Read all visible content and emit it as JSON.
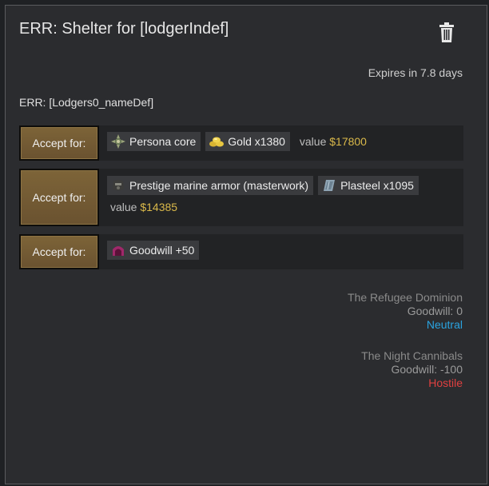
{
  "dialog": {
    "title": "ERR: Shelter for [lodgerIndef]",
    "expires": "Expires in 7.8 days",
    "subtitle": "ERR: [Lodgers0_nameDef]",
    "trash_icon": "trash-icon"
  },
  "options": [
    {
      "accept_label": "Accept for:",
      "items": [
        {
          "label": "Persona core",
          "icon": "persona-core-icon"
        },
        {
          "label": "Gold x1380",
          "icon": "gold-icon"
        }
      ],
      "value_label": "value",
      "value_amount": "$17800"
    },
    {
      "accept_label": "Accept for:",
      "items": [
        {
          "label": "Prestige marine armor (masterwork)",
          "icon": "armor-icon"
        },
        {
          "label": "Plasteel x1095",
          "icon": "plasteel-icon"
        }
      ],
      "value_label": "value",
      "value_amount": "$14385"
    },
    {
      "accept_label": "Accept for:",
      "items": [
        {
          "label": "Goodwill +50",
          "icon": "goodwill-icon"
        }
      ]
    }
  ],
  "factions": [
    {
      "name": "The Refugee Dominion",
      "goodwill": "Goodwill: 0",
      "status": "Neutral",
      "status_color": "#2aa3e0"
    },
    {
      "name": "The Night Cannibals",
      "goodwill": "Goodwill: -100",
      "status": "Hostile",
      "status_color": "#e04040"
    }
  ],
  "colors": {
    "accept_button": "#7d6438",
    "value_amount": "#d9b84a",
    "panel": "#2b2c2f"
  }
}
